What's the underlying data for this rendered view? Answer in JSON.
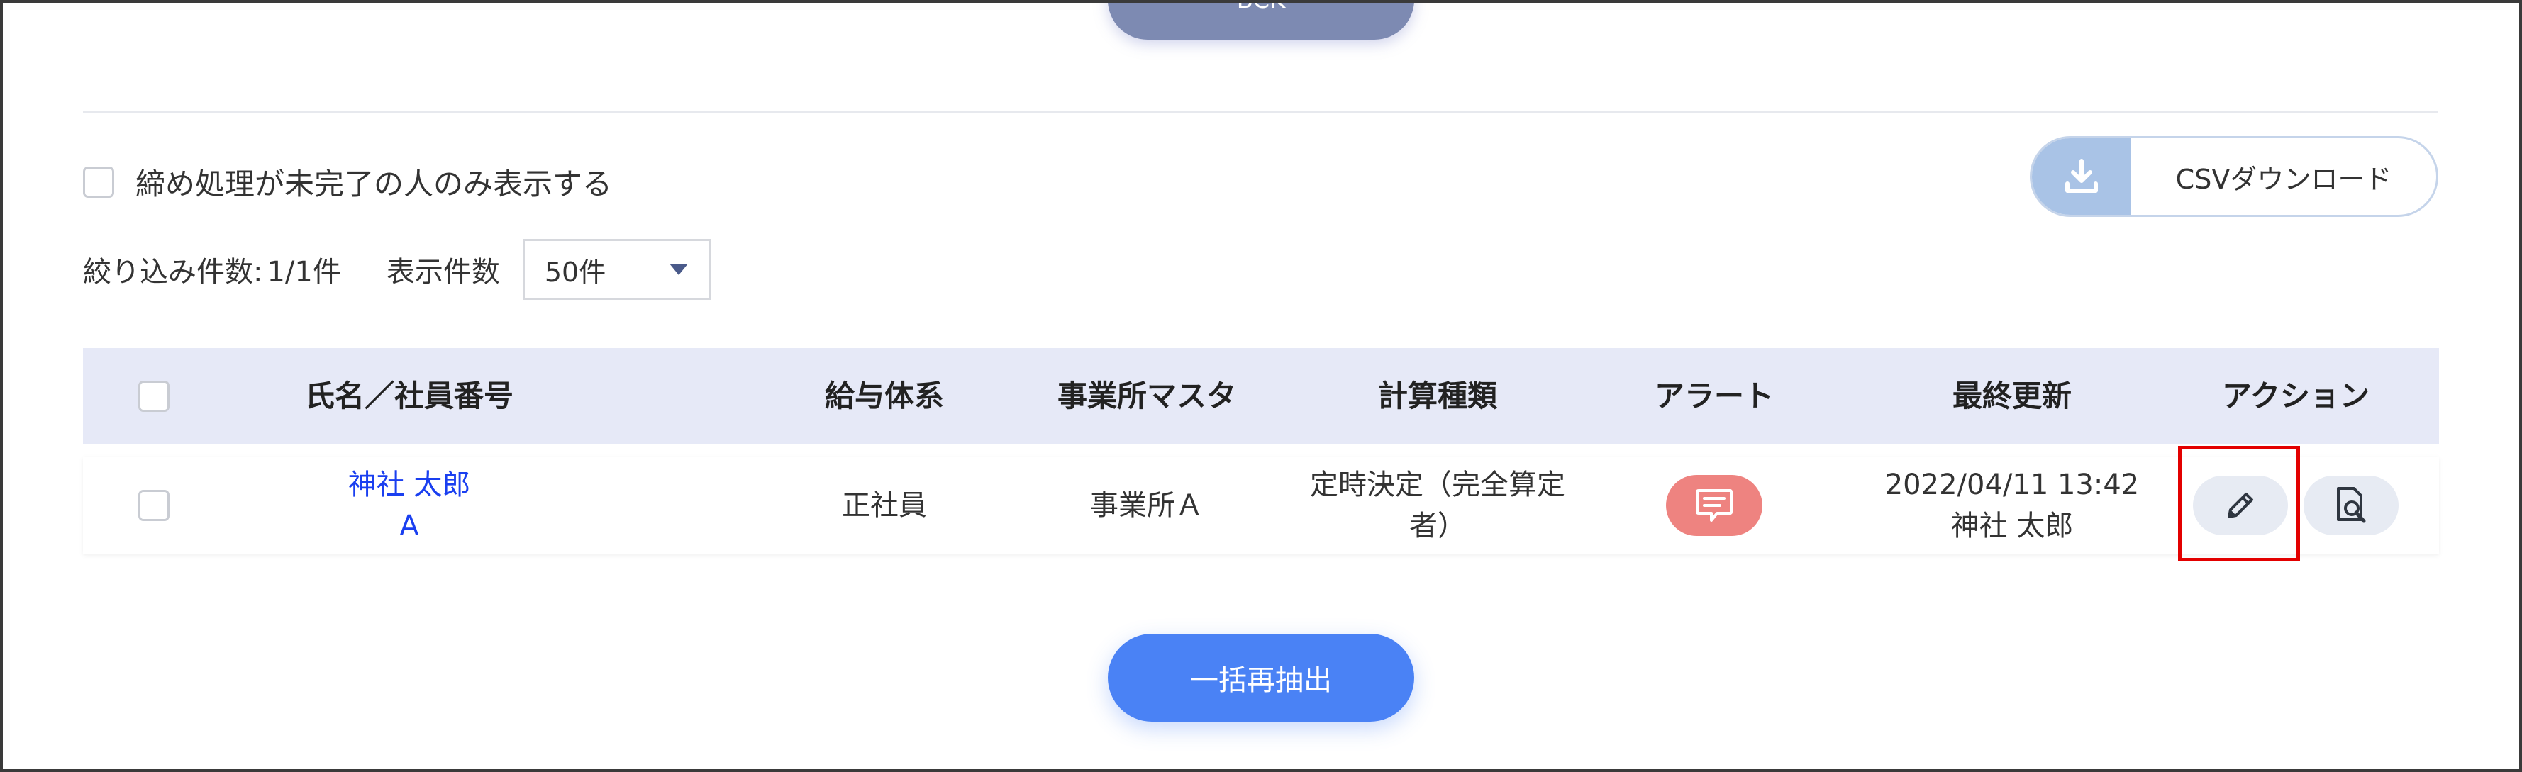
{
  "top_button": {
    "label": "BCK"
  },
  "filter": {
    "incomplete_only_label": "締め処理が未完了の人のみ表示する",
    "checked": false
  },
  "csv_download": {
    "label": "CSVダウンロード",
    "icon": "download-icon"
  },
  "counts": {
    "filtered_label": "絞り込み件数:",
    "filtered_value": "1/1件",
    "per_page_label": "表示件数",
    "per_page_value": "50件"
  },
  "table": {
    "headers": {
      "name": "氏名／社員番号",
      "pay_system": "給与体系",
      "office": "事業所マスタ",
      "calc_type": "計算種類",
      "alert": "アラート",
      "last_updated": "最終更新",
      "action": "アクション"
    },
    "rows": [
      {
        "name": "神社 太郎",
        "employee_no": "A",
        "pay_system": "正社員",
        "office": "事業所Ａ",
        "calc_type": "定時決定（完全算定者）",
        "alert_icon": "message-alert-icon",
        "updated_at": "2022/04/11 13:42",
        "updated_by": "神社 太郎"
      }
    ]
  },
  "bottom_button": {
    "label": "一括再抽出"
  },
  "colors": {
    "primary": "#4a82f5",
    "header_bg": "#e6e9f7",
    "alert": "#ee8380",
    "link": "#1a3ff0",
    "highlight": "#e30000"
  }
}
